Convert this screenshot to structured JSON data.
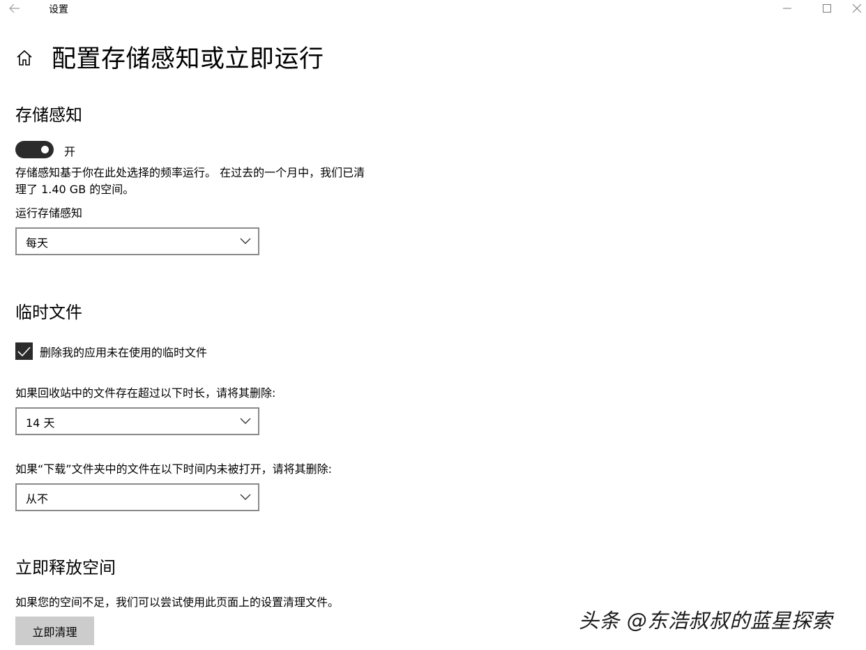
{
  "window": {
    "app_title": "设置",
    "back_icon": "back-arrow-icon",
    "min_icon": "minimize-icon",
    "max_icon": "maximize-icon",
    "close_icon": "close-icon"
  },
  "page": {
    "home_icon": "home-icon",
    "title": "配置存储感知或立即运行"
  },
  "storage_sense": {
    "heading": "存储感知",
    "toggle_state": "on",
    "toggle_label": "开",
    "description_line1": "存储感知基于你在此处选择的频率运行。 在过去的一个月中，我们已清",
    "description_line2": "理了 1.40 GB 的空间。",
    "run_label": "运行存储感知",
    "run_value": "每天"
  },
  "temp_files": {
    "heading": "临时文件",
    "delete_checkbox_checked": true,
    "delete_checkbox_label": "删除我的应用未在使用的临时文件",
    "recycle_label": "如果回收站中的文件存在超过以下时长，请将其删除:",
    "recycle_value": "14 天",
    "downloads_label": "如果“下载”文件夹中的文件在以下时间内未被打开，请将其删除:",
    "downloads_value": "从不"
  },
  "free_space": {
    "heading": "立即释放空间",
    "description": "如果您的空间不足，我们可以尝试使用此页面上的设置清理文件。",
    "button_label": "立即清理"
  },
  "watermark": "头条 @东浩叔叔的蓝星探索",
  "colors": {
    "toggle_on": "#2b2b2b",
    "dropdown_border": "#8a8a8a",
    "button_bg": "#cccccc"
  }
}
